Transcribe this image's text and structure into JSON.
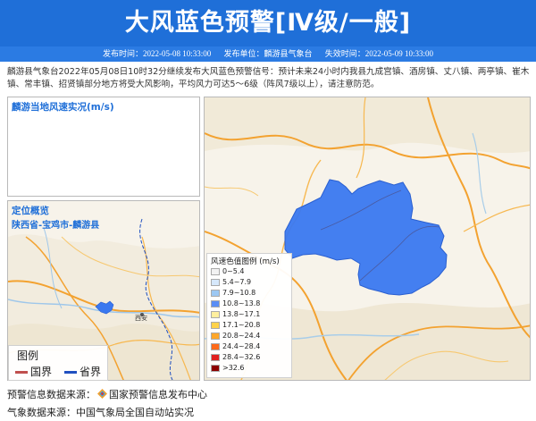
{
  "header": {
    "title": "大风蓝色预警[Ⅳ级/一般]",
    "published_time": "发布时间：2022-05-08 10:33:00",
    "publisher": "发布单位：麟游县气象台",
    "expire_time": "失效时间：2022-05-09 10:33:00"
  },
  "description": "麟游县气象台2022年05月08日10时32分继续发布大风蓝色预警信号：预计未来24小时内我县九成宫镇、酒房镇、丈八镇、两亭镇、崔木镇、常丰镇、招贤镇部分地方将受大风影响，平均风力可达5～6级（阵风7级以上），请注意防范。",
  "wind_panel": {
    "title": "麟游当地风速实况(m/s)"
  },
  "location_panel": {
    "title": "定位概览",
    "region": "陕西省-宝鸡市-麟游县",
    "city_label": "西安"
  },
  "mini_legend": {
    "title": "图例",
    "national_border": "国界",
    "provincial_border": "省界"
  },
  "wind_legend": {
    "title": "风速色值图例 (m/s)",
    "items": [
      {
        "label": "0~5.4",
        "color": "#f2f2f2"
      },
      {
        "label": "5.4~7.9",
        "color": "#d6e8fb"
      },
      {
        "label": "7.9~10.8",
        "color": "#9cc8f3"
      },
      {
        "label": "10.8~13.8",
        "color": "#5a8ef5"
      },
      {
        "label": "13.8~17.1",
        "color": "#ffef9e"
      },
      {
        "label": "17.1~20.8",
        "color": "#ffd24a"
      },
      {
        "label": "20.8~24.4",
        "color": "#ffa62a"
      },
      {
        "label": "24.4~28.4",
        "color": "#ff6a1a"
      },
      {
        "label": "28.4~32.6",
        "color": "#e02020"
      },
      {
        "label": ">32.6",
        "color": "#8b0000"
      }
    ]
  },
  "footer": {
    "warning_source": "预警信息数据来源：",
    "warning_source_name": "国家预警信息发布中心",
    "weather_source": "气象数据来源：中国气象局全国自动站实况"
  },
  "colors": {
    "header_blue": "#1f6fd8",
    "alert_blue": "#3a78f0",
    "national_border": "#c0504d",
    "provincial_border": "#2050c0"
  }
}
